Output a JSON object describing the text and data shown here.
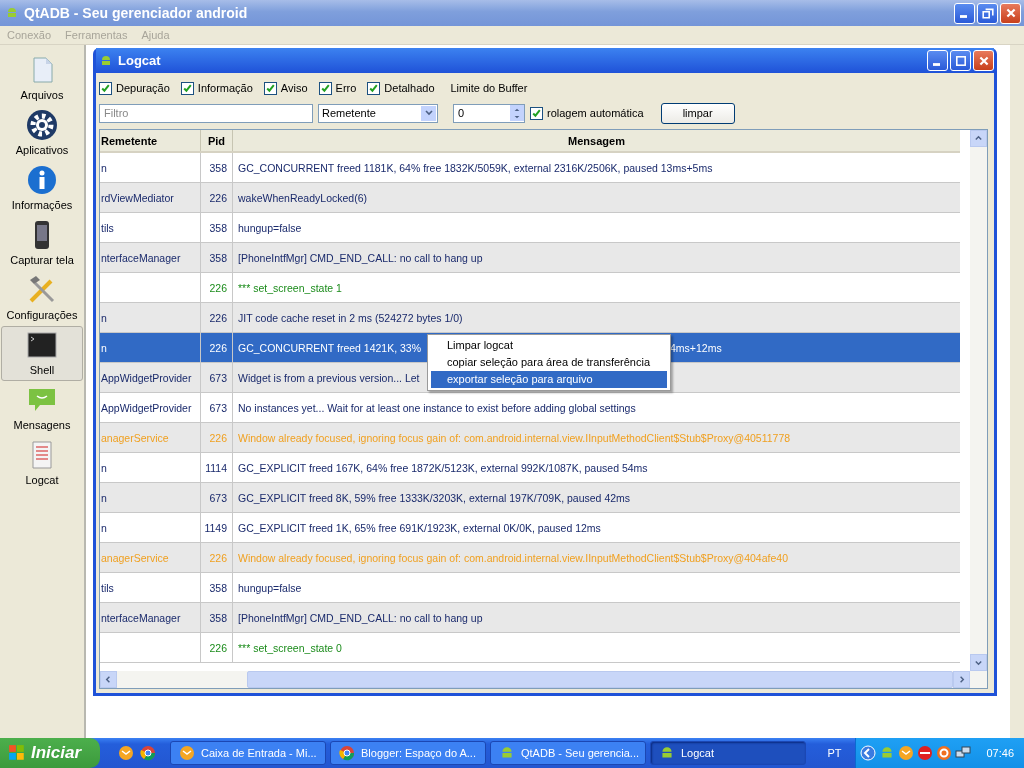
{
  "window": {
    "title": "QtADB - Seu gerenciador android"
  },
  "menu": [
    {
      "label": "Conexão",
      "disabled": true
    },
    {
      "label": "Ferramentas",
      "disabled": true
    },
    {
      "label": "Ajuda",
      "disabled": true
    }
  ],
  "sidebar": {
    "items": [
      {
        "kind": "files",
        "label": "Arquivos",
        "selected": false
      },
      {
        "kind": "apps",
        "label": "Aplicativos",
        "selected": false
      },
      {
        "kind": "info",
        "label": "Informações",
        "selected": false
      },
      {
        "kind": "screenshot",
        "label": "Capturar tela",
        "selected": false
      },
      {
        "kind": "settings",
        "label": "Configurações",
        "selected": false
      },
      {
        "kind": "shell",
        "label": "Shell",
        "selected": true
      },
      {
        "kind": "messages",
        "label": "Mensagens",
        "selected": false
      },
      {
        "kind": "logcat",
        "label": "Logcat",
        "selected": false
      }
    ]
  },
  "logcat": {
    "title": "Logcat",
    "levels": [
      {
        "label": "Depuração",
        "checked": true
      },
      {
        "label": "Informação",
        "checked": true
      },
      {
        "label": "Aviso",
        "checked": true
      },
      {
        "label": "Erro",
        "checked": true
      },
      {
        "label": "Detalhado",
        "checked": true
      }
    ],
    "buffer_label": "Limite do Buffer",
    "filter": {
      "placeholder": "Filtro"
    },
    "filter_by": "Remetente",
    "buffer_limit": "0",
    "autoscroll": {
      "label": "rolagem automática",
      "checked": true
    },
    "clear_button": "limpar",
    "table": {
      "columns": [
        "Remetente",
        "Pid",
        "Mensagem"
      ],
      "rows": [
        {
          "sender": "n",
          "pid": "358",
          "message": "GC_CONCURRENT freed 1181K, 64% free 1832K/5059K, external 2316K/2506K, paused 13ms+5ms",
          "color": "#1a2a6c",
          "selected": false
        },
        {
          "sender": "rdViewMediator",
          "pid": "226",
          "message": "wakeWhenReadyLocked(6)",
          "color": "#1a2a6c",
          "selected": false
        },
        {
          "sender": "tils",
          "pid": "358",
          "message": "hungup=false",
          "color": "#1a2a6c",
          "selected": false
        },
        {
          "sender": "nterfaceManager",
          "pid": "358",
          "message": "[PhoneIntfMgr] CMD_END_CALL: no call to hang up",
          "color": "#1a2a6c",
          "selected": false
        },
        {
          "pid": "226",
          "message": "*** set_screen_state 1",
          "color": "#1c8c1c",
          "selected": false
        },
        {
          "sender": "n",
          "pid": "226",
          "message": "JIT code cache reset in 2 ms (524272 bytes 1/0)",
          "color": "#1a2a6c",
          "selected": false
        },
        {
          "sender": "n",
          "pid": "226",
          "message": "GC_CONCURRENT freed 1421K, 33%",
          "message_tail": "4ms+12ms",
          "color": "#ffffff",
          "selected": true
        },
        {
          "sender": "AppWidgetProvider",
          "pid": "673",
          "message": "Widget is from a previous version... Let",
          "color": "#1a2a6c",
          "selected": false
        },
        {
          "sender": "AppWidgetProvider",
          "pid": "673",
          "message": "No instances yet... Wait for at least one instance to exist before adding global settings",
          "color": "#1a2a6c",
          "selected": false
        },
        {
          "sender": "anagerService",
          "pid": "226",
          "message": "Window already focused, ignoring focus gain of: com.android.internal.view.IInputMethodClient$Stub$Proxy@40511778",
          "color": "#f0a020",
          "selected": false
        },
        {
          "sender": "n",
          "pid": "1114",
          "message": "GC_EXPLICIT freed 167K, 64% free 1872K/5123K, external 992K/1087K, paused 54ms",
          "color": "#1a2a6c",
          "selected": false
        },
        {
          "sender": "n",
          "pid": "673",
          "message": "GC_EXPLICIT freed 8K, 59% free 1333K/3203K, external 197K/709K, paused 42ms",
          "color": "#1a2a6c",
          "selected": false
        },
        {
          "sender": "n",
          "pid": "1149",
          "message": "GC_EXPLICIT freed 1K, 65% free 691K/1923K, external 0K/0K, paused 12ms",
          "color": "#1a2a6c",
          "selected": false
        },
        {
          "sender": "anagerService",
          "pid": "226",
          "message": "Window already focused, ignoring focus gain of: com.android.internal.view.IInputMethodClient$Stub$Proxy@404afe40",
          "color": "#f0a020",
          "selected": false
        },
        {
          "sender": "tils",
          "pid": "358",
          "message": "hungup=false",
          "color": "#1a2a6c",
          "selected": false
        },
        {
          "sender": "nterfaceManager",
          "pid": "358",
          "message": "[PhoneIntfMgr] CMD_END_CALL: no call to hang up",
          "color": "#1a2a6c",
          "selected": false
        },
        {
          "pid": "226",
          "message": "*** set_screen_state 0",
          "color": "#1c8c1c",
          "selected": false
        }
      ]
    },
    "context_menu": [
      {
        "label": "Limpar logcat",
        "selected": false
      },
      {
        "label": "copiar seleção para área de transferência",
        "selected": false
      },
      {
        "label": "exportar seleção para arquivo",
        "selected": true
      }
    ]
  },
  "taskbar": {
    "start": "Iniciar",
    "tasks": [
      {
        "kind": "mail",
        "label": "Caixa de Entrada - Mi...",
        "selected": false
      },
      {
        "kind": "browser",
        "label": "Blogger: Espaço do A...",
        "selected": false
      },
      {
        "kind": "android",
        "label": "QtADB - Seu gerencia...",
        "selected": false
      },
      {
        "kind": "android",
        "label": "Logcat",
        "selected": true
      }
    ],
    "language": "PT",
    "clock": "07:46"
  }
}
